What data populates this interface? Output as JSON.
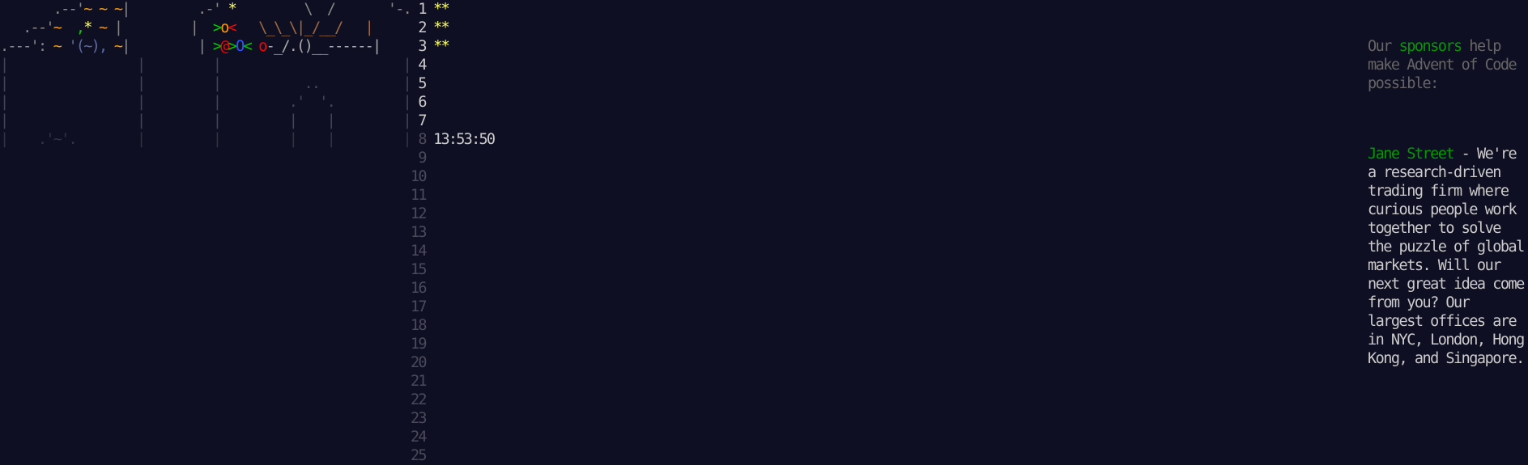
{
  "calendar": {
    "art_lines": [
      {
        "segments": [
          {
            "text": "       .--'",
            "color": "gray"
          },
          {
            "text": "~ ~ ~",
            "color": "orange"
          },
          {
            "text": "|",
            "color": "gray"
          },
          {
            "text": "         .-' ",
            "color": "gray"
          },
          {
            "text": "*",
            "color": "yellow"
          },
          {
            "text": "         \\  /       '-.",
            "color": "gray"
          }
        ]
      },
      {
        "segments": [
          {
            "text": "   .--'",
            "color": "gray"
          },
          {
            "text": "~  ",
            "color": "orange"
          },
          {
            "text": ",",
            "color": "green"
          },
          {
            "text": "*",
            "color": "yellow"
          },
          {
            "text": " ~ ",
            "color": "orange"
          },
          {
            "text": "|",
            "color": "gray"
          },
          {
            "text": "         |  ",
            "color": "gray"
          },
          {
            "text": ">",
            "color": "green"
          },
          {
            "text": "o",
            "color": "orange"
          },
          {
            "text": "<",
            "color": "red"
          },
          {
            "text": "   \\_\\_\\|_/__/   |",
            "color": "brown"
          }
        ]
      },
      {
        "segments": [
          {
            "text": ".---': ",
            "color": "gray"
          },
          {
            "text": "~ ",
            "color": "orange"
          },
          {
            "text": "'(~), ",
            "color": "bluegray"
          },
          {
            "text": "~",
            "color": "orange"
          },
          {
            "text": "|",
            "color": "gray"
          },
          {
            "text": "         | ",
            "color": "gray"
          },
          {
            "text": ">",
            "color": "green"
          },
          {
            "text": "@",
            "color": "red"
          },
          {
            "text": ">",
            "color": "green"
          },
          {
            "text": "O",
            "color": "blue"
          },
          {
            "text": "< ",
            "color": "green"
          },
          {
            "text": "o",
            "color": "red"
          },
          {
            "text": "-_/.()__------|",
            "color": "lgray"
          }
        ]
      },
      {
        "segments": [
          {
            "text": "|                 |         |                        |",
            "color": "dim2"
          }
        ]
      },
      {
        "segments": [
          {
            "text": "|                 |         |           ..           |",
            "color": "dim2"
          }
        ]
      },
      {
        "segments": [
          {
            "text": "|                 |         |         .'  '.         |",
            "color": "dim2"
          }
        ]
      },
      {
        "segments": [
          {
            "text": "|                 |         |         |    |         |",
            "color": "dim2"
          }
        ]
      },
      {
        "segments": [
          {
            "text": "|    .'~'.        |         |         |    |         |",
            "color": "dim"
          }
        ]
      }
    ],
    "days": [
      {
        "num": "1",
        "stars": "**",
        "timer": "",
        "unlocked": true
      },
      {
        "num": "2",
        "stars": "**",
        "timer": "",
        "unlocked": true
      },
      {
        "num": "3",
        "stars": "**",
        "timer": "",
        "unlocked": true
      },
      {
        "num": "4",
        "stars": "",
        "timer": "",
        "unlocked": true
      },
      {
        "num": "5",
        "stars": "",
        "timer": "",
        "unlocked": true
      },
      {
        "num": "6",
        "stars": "",
        "timer": "",
        "unlocked": true
      },
      {
        "num": "7",
        "stars": "",
        "timer": "",
        "unlocked": true
      },
      {
        "num": "8",
        "stars": "",
        "timer": "13:53:50",
        "unlocked": false
      },
      {
        "num": "9",
        "stars": "",
        "timer": "",
        "unlocked": false
      },
      {
        "num": "10",
        "stars": "",
        "timer": "",
        "unlocked": false
      },
      {
        "num": "11",
        "stars": "",
        "timer": "",
        "unlocked": false
      },
      {
        "num": "12",
        "stars": "",
        "timer": "",
        "unlocked": false
      },
      {
        "num": "13",
        "stars": "",
        "timer": "",
        "unlocked": false
      },
      {
        "num": "14",
        "stars": "",
        "timer": "",
        "unlocked": false
      },
      {
        "num": "15",
        "stars": "",
        "timer": "",
        "unlocked": false
      },
      {
        "num": "16",
        "stars": "",
        "timer": "",
        "unlocked": false
      },
      {
        "num": "17",
        "stars": "",
        "timer": "",
        "unlocked": false
      },
      {
        "num": "18",
        "stars": "",
        "timer": "",
        "unlocked": false
      },
      {
        "num": "19",
        "stars": "",
        "timer": "",
        "unlocked": false
      },
      {
        "num": "20",
        "stars": "",
        "timer": "",
        "unlocked": false
      },
      {
        "num": "21",
        "stars": "",
        "timer": "",
        "unlocked": false
      },
      {
        "num": "22",
        "stars": "",
        "timer": "",
        "unlocked": false
      },
      {
        "num": "23",
        "stars": "",
        "timer": "",
        "unlocked": false
      },
      {
        "num": "24",
        "stars": "",
        "timer": "",
        "unlocked": false
      },
      {
        "num": "25",
        "stars": "",
        "timer": "",
        "unlocked": false
      }
    ]
  },
  "sidebar": {
    "intro_before": "Our ",
    "intro_link": "sponsors",
    "intro_after": " help make Advent of Code possible:",
    "sponsor_name": "Jane Street",
    "sponsor_sep": " - ",
    "sponsor_text": "We're a research-driven trading firm where curious people work together to solve the puzzle of global markets. Will our next great idea come from you? Our largest offices are in NYC, London, Hong Kong, and Singapore."
  },
  "colors": {
    "background": "#0f0f23",
    "text": "#cccccc",
    "star": "#ffff66",
    "link": "#009900",
    "muted": "#666666"
  }
}
